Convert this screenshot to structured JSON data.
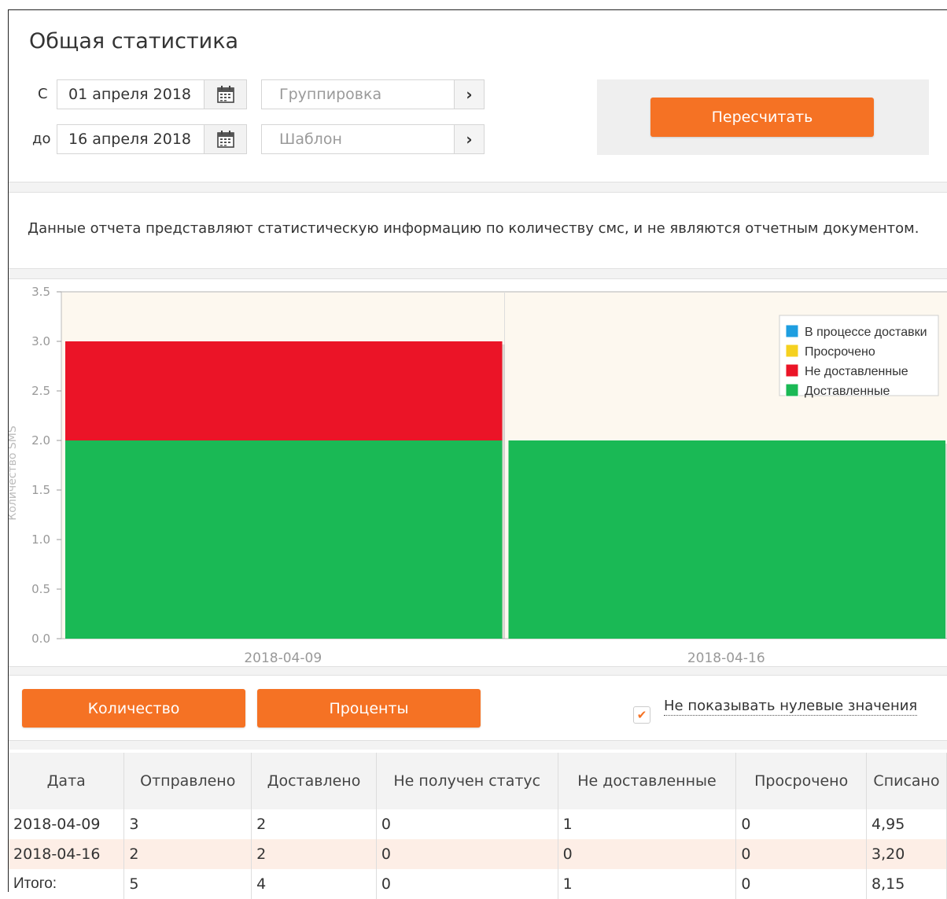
{
  "page": {
    "title": "Общая статистика"
  },
  "filters": {
    "from_label": "С",
    "from_date": "01 апреля 2018",
    "to_label": "до",
    "to_date": "16 апреля 2018",
    "grouping_placeholder": "Группировка",
    "template_placeholder": "Шаблон",
    "recalc_label": "Пересчитать"
  },
  "notice": "Данные отчета представляют статистическую информацию по количеству смс, и не являются отчетным документом.",
  "chart_data": {
    "type": "bar",
    "stacked": true,
    "ylabel": "Количество SMS",
    "ylim": [
      0,
      3.5
    ],
    "yticks": [
      "0.0",
      "0.5",
      "1.0",
      "1.5",
      "2.0",
      "2.5",
      "3.0",
      "3.5"
    ],
    "categories": [
      "2018-04-09",
      "2018-04-16"
    ],
    "series": [
      {
        "name": "Доставленные",
        "color": "#1ab955",
        "values": [
          2,
          2
        ]
      },
      {
        "name": "Не доставленные",
        "color": "#eb1427",
        "values": [
          1,
          0
        ]
      },
      {
        "name": "Просрочено",
        "color": "#f5d11f",
        "values": [
          0,
          0
        ]
      },
      {
        "name": "В процессе доставки",
        "color": "#1e9ee0",
        "values": [
          0,
          0
        ]
      }
    ],
    "legend_order": [
      "В процессе доставки",
      "Просрочено",
      "Не доставленные",
      "Доставленные"
    ],
    "legend_position": "top-right",
    "grid": true
  },
  "controls": {
    "count_button": "Количество",
    "percent_button": "Проценты",
    "hide_zero_checked": true,
    "hide_zero_label": "Не показывать нулевые значения"
  },
  "table": {
    "headers": [
      "Дата",
      "Отправлено",
      "Доставлено",
      "Не получен статус",
      "Не доставленные",
      "Просрочено",
      "Списано"
    ],
    "rows": [
      [
        "2018-04-09",
        "3",
        "2",
        "0",
        "1",
        "0",
        "4,95"
      ],
      [
        "2018-04-16",
        "2",
        "2",
        "0",
        "0",
        "0",
        "3,20"
      ]
    ],
    "total": [
      "Итого:",
      "5",
      "4",
      "0",
      "1",
      "0",
      "8,15"
    ]
  },
  "colors": {
    "accent": "#f57224",
    "chart_bg": "#fdf8ef"
  }
}
